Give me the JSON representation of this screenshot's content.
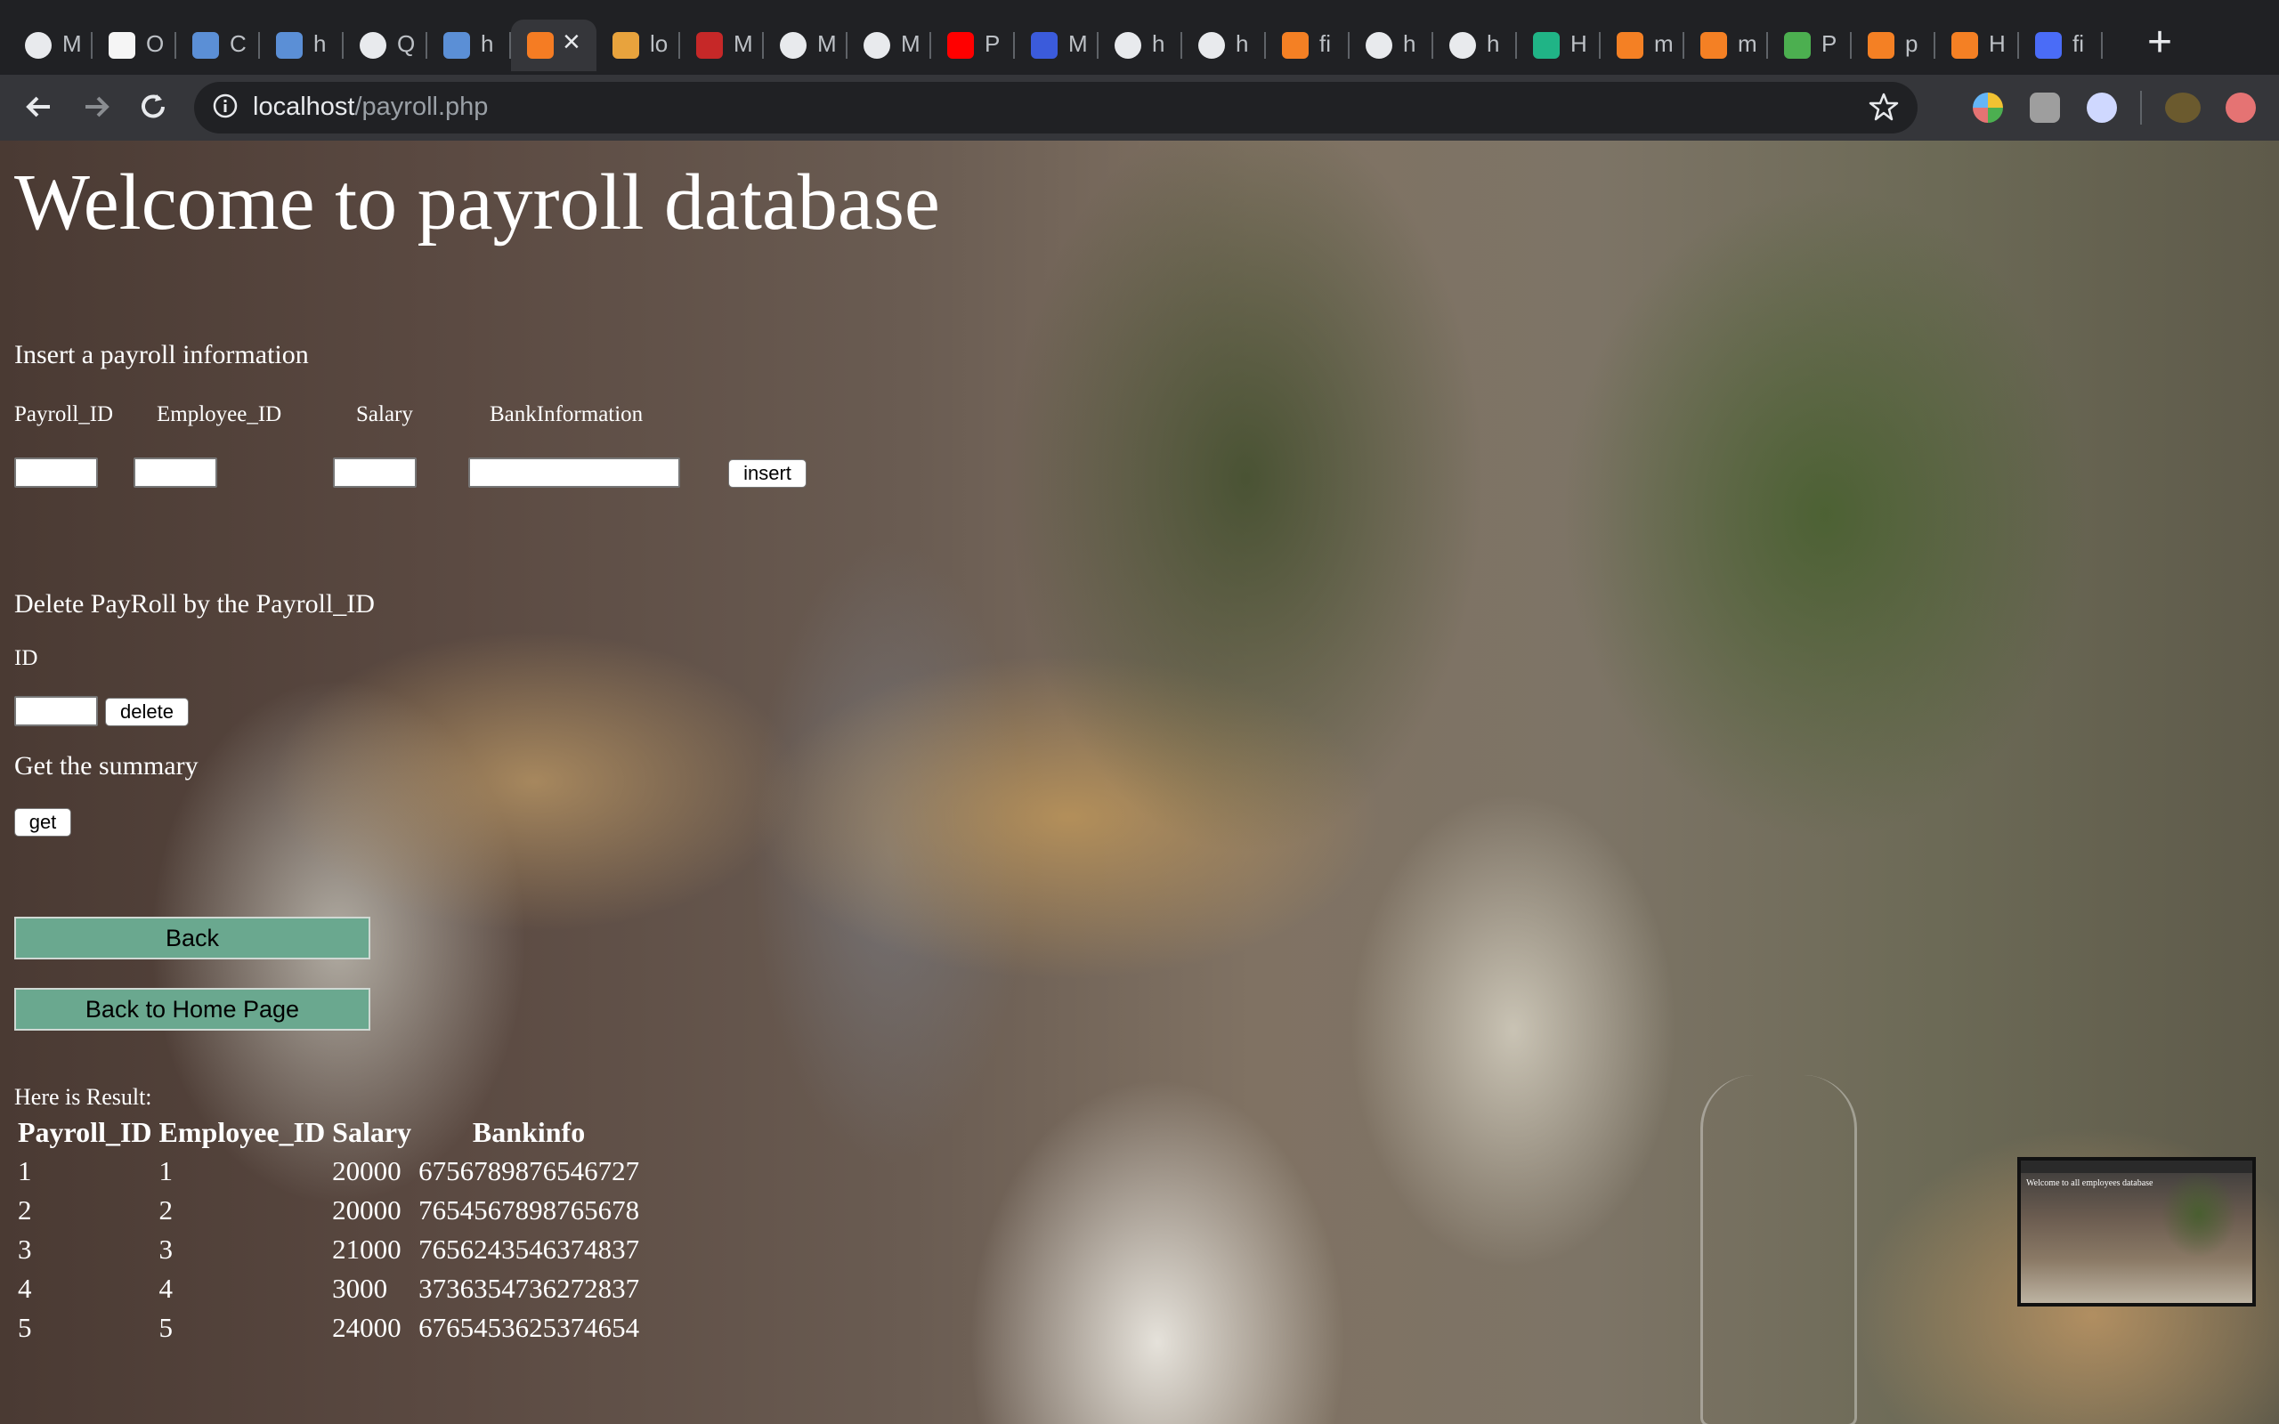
{
  "browser": {
    "tabs": [
      {
        "title": "M",
        "icon": "globe-icon"
      },
      {
        "title": "O",
        "icon": "white-square-icon"
      },
      {
        "title": "C",
        "icon": "p-logo-icon"
      },
      {
        "title": "h",
        "icon": "p-logo-icon"
      },
      {
        "title": "Q",
        "icon": "globe-icon"
      },
      {
        "title": "h",
        "icon": "p-logo-icon"
      },
      {
        "title": "",
        "icon": "xampp-icon",
        "active": true
      },
      {
        "title": "lo",
        "icon": "pma-icon"
      },
      {
        "title": "M",
        "icon": "ubc-canvas-icon"
      },
      {
        "title": "M",
        "icon": "globe-icon"
      },
      {
        "title": "M",
        "icon": "globe-icon"
      },
      {
        "title": "P",
        "icon": "youtube-icon"
      },
      {
        "title": "M",
        "icon": "facebook-icon"
      },
      {
        "title": "h",
        "icon": "globe-icon"
      },
      {
        "title": "h",
        "icon": "globe-icon"
      },
      {
        "title": "fi",
        "icon": "stackoverflow-icon"
      },
      {
        "title": "h",
        "icon": "globe-icon"
      },
      {
        "title": "h",
        "icon": "globe-icon"
      },
      {
        "title": "H",
        "icon": "hex-icon"
      },
      {
        "title": "m",
        "icon": "stackoverflow-icon"
      },
      {
        "title": "m",
        "icon": "stackoverflow-icon"
      },
      {
        "title": "P",
        "icon": "w3-icon"
      },
      {
        "title": "p",
        "icon": "stackoverflow-icon"
      },
      {
        "title": "H",
        "icon": "stackoverflow-icon"
      },
      {
        "title": "fi",
        "icon": "cs-icon"
      }
    ],
    "url_host": "localhost",
    "url_path": "/payroll.php",
    "colors": {
      "chrome_dark": "#202124",
      "toolbar": "#35363a",
      "button_green": "#6aa88f"
    }
  },
  "page": {
    "title": "Welcome to payroll database",
    "insert": {
      "heading": "Insert a payroll information",
      "labels": [
        "Payroll_ID",
        "Employee_ID",
        "Salary",
        "BankInformation"
      ],
      "button": "insert"
    },
    "delete": {
      "heading": "Delete PayRoll by the Payroll_ID",
      "id_label": "ID",
      "button": "delete"
    },
    "summary": {
      "heading": "Get the summary",
      "button": "get"
    },
    "back_button": "Back",
    "home_button": "Back to Home Page",
    "result": {
      "label": "Here is Result:",
      "headers": [
        "Payroll_ID",
        "Employee_ID",
        "Salary",
        "Bankinfo"
      ],
      "rows": [
        [
          "1",
          "1",
          "20000",
          "6756789876546727"
        ],
        [
          "2",
          "2",
          "20000",
          "7654567898765678"
        ],
        [
          "3",
          "3",
          "21000",
          "7656243546374837"
        ],
        [
          "4",
          "4",
          "3000",
          "3736354736272837"
        ],
        [
          "5",
          "5",
          "24000",
          "6765453625374654"
        ]
      ]
    },
    "thumbnail_title": "Welcome to all employees database"
  }
}
